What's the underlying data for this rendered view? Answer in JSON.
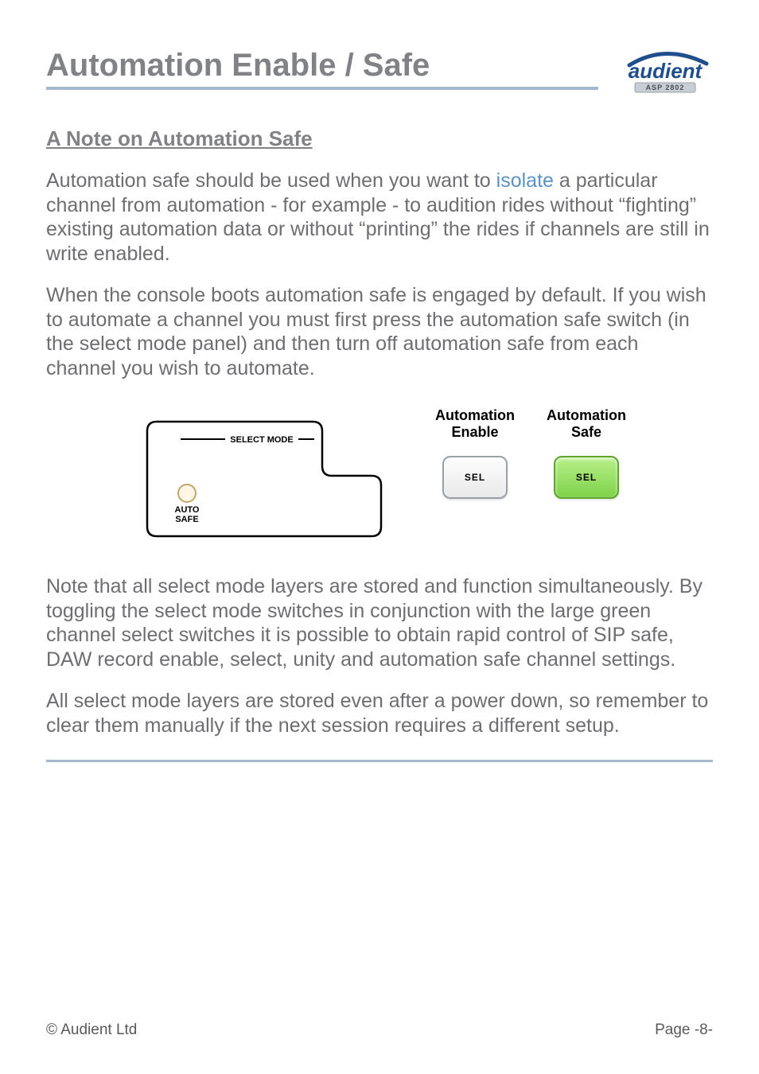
{
  "header": {
    "title": "Automation Enable / Safe",
    "logo_brand": "audient",
    "logo_model": "ASP 2802"
  },
  "section": {
    "heading": "A Note on Automation Safe"
  },
  "para1": {
    "pre": "Automation safe should be used when you want to ",
    "highlight": "isolate",
    "post": " a particular channel from automation - for example - to audition rides without “fighting” existing automation data or without “printing” the rides if channels are still in write enabled."
  },
  "para2": "When the console boots automation safe is engaged by default. If you wish to automate a channel you must first press the automation safe switch (in the select mode panel) and then turn off automation safe from each channel you wish to automate.",
  "diagram": {
    "panel_label": "SELECT MODE",
    "button_label_line1": "AUTO",
    "button_label_line2": "SAFE",
    "col1_title": "Automation\nEnable",
    "col2_title": "Automation\nSafe",
    "sel_label": "SEL"
  },
  "para3": "Note that all select mode layers are stored and function simultaneously. By toggling the select mode switches in conjunction with the large green channel select switches it is possible to obtain rapid control of SIP safe, DAW record enable, select, unity and automation safe channel settings.",
  "para4": "All select mode layers are stored even after a power down, so remember to clear them manually if the next session requires a different setup.",
  "footer": {
    "left": "© Audient Ltd",
    "right": "Page -8-"
  }
}
